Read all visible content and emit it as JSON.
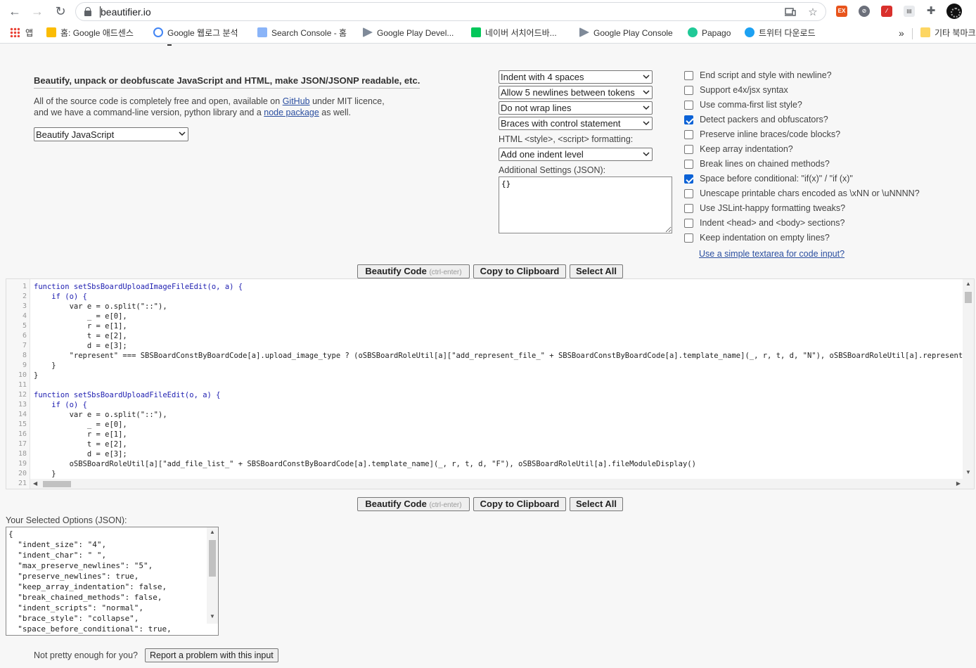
{
  "browser": {
    "url": "beautifier.io",
    "bookmarks": [
      {
        "label": "앱",
        "color": "#e94235"
      },
      {
        "label": "홈: Google 애드센스",
        "color": "#fbbc04"
      },
      {
        "label": "Google 웹로그 분석",
        "color": "#4285f4"
      },
      {
        "label": "Search Console - 홈",
        "color": "#4285f4"
      },
      {
        "label": "Google Play Devel...",
        "color": "#34a853"
      },
      {
        "label": "네이버 서치어드바...",
        "color": "#03c75a"
      },
      {
        "label": "Google Play Console",
        "color": "#34a853"
      },
      {
        "label": "Papago",
        "color": "#20c997"
      },
      {
        "label": "트위터 다운로드",
        "color": "#1da1f2"
      }
    ],
    "overflow_label": "»",
    "other_bookmarks": "기타 북마크"
  },
  "header": {
    "tagline": "Beautify, unpack or deobfuscate JavaScript and HTML, make JSON/JSONP readable, etc.",
    "intro_1a": "All of the source code is completely free and open, available on ",
    "intro_github": "GitHub",
    "intro_1b": " under MIT licence,",
    "intro_2a": "and we have a command-line version, python library and a ",
    "intro_node": "node package",
    "intro_2b": " as well.",
    "mode": "Beautify JavaScript"
  },
  "settings": {
    "indent": "Indent with 4 spaces",
    "newlines": "Allow 5 newlines between tokens",
    "wrap": "Do not wrap lines",
    "braces": "Braces with control statement",
    "html_label": "HTML <style>, <script> formatting:",
    "html_indent": "Add one indent level",
    "additional_label": "Additional Settings (JSON):",
    "additional_value": "{}"
  },
  "checkboxes": [
    {
      "label": "End script and style with newline?",
      "checked": false
    },
    {
      "label": "Support e4x/jsx syntax",
      "checked": false
    },
    {
      "label": "Use comma-first list style?",
      "checked": false
    },
    {
      "label": "Detect packers and obfuscators?",
      "checked": true
    },
    {
      "label": "Preserve inline braces/code blocks?",
      "checked": false
    },
    {
      "label": "Keep array indentation?",
      "checked": false
    },
    {
      "label": "Break lines on chained methods?",
      "checked": false
    },
    {
      "label": "Space before conditional: \"if(x)\" / \"if (x)\"",
      "checked": true
    },
    {
      "label": "Unescape printable chars encoded as \\xNN or \\uNNNN?",
      "checked": false
    },
    {
      "label": "Use JSLint-happy formatting tweaks?",
      "checked": false
    },
    {
      "label": "Indent <head> and <body> sections?",
      "checked": false
    },
    {
      "label": "Keep indentation on empty lines?",
      "checked": false
    }
  ],
  "simple_textarea_link": "Use a simple textarea for code input?",
  "buttons": {
    "beautify": "Beautify Code",
    "beautify_hint": "(ctrl-enter)",
    "copy": "Copy to Clipboard",
    "select_all": "Select All"
  },
  "code": {
    "line_numbers": [
      "1",
      "2",
      "3",
      "4",
      "5",
      "6",
      "7",
      "8",
      "9",
      "10",
      "11",
      "12",
      "13",
      "14",
      "15",
      "16",
      "17",
      "18",
      "19",
      "20",
      "21"
    ],
    "lines": [
      "function setSbsBoardUploadImageFileEdit(o, a) {",
      "    if (o) {",
      "        var e = o.split(\"::\"),",
      "            _ = e[0],",
      "            r = e[1],",
      "            t = e[2],",
      "            d = e[3];",
      "        \"represent\" === SBSBoardConstByBoardCode[a].upload_image_type ? (oSBSBoardRoleUtil[a][\"add_represent_file_\" + SBSBoardConstByBoardCode[a].template_name](_, r, t, d, \"N\"), oSBSBoardRoleUtil[a].representFileCheck(r",
      "    }",
      "}",
      "",
      "function setSbsBoardUploadFileEdit(o, a) {",
      "    if (o) {",
      "        var e = o.split(\"::\"),",
      "            _ = e[0],",
      "            r = e[1],",
      "            t = e[2],",
      "            d = e[3];",
      "        oSBSBoardRoleUtil[a][\"add_file_list_\" + SBSBoardConstByBoardCode[a].template_name](_, r, t, d, \"F\"), oSBSBoardRoleUtil[a].fileModuleDisplay()",
      "    }",
      "}"
    ]
  },
  "options": {
    "label": "Your Selected Options (JSON):",
    "lines": [
      "{",
      "  \"indent_size\": \"4\",",
      "  \"indent_char\": \" \",",
      "  \"max_preserve_newlines\": \"5\",",
      "  \"preserve_newlines\": true,",
      "  \"keep_array_indentation\": false,",
      "  \"break_chained_methods\": false,",
      "  \"indent_scripts\": \"normal\",",
      "  \"brace_style\": \"collapse\",",
      "  \"space_before_conditional\": true,"
    ]
  },
  "footer": {
    "question": "Not pretty enough for you?",
    "report": "Report a problem with this input"
  }
}
